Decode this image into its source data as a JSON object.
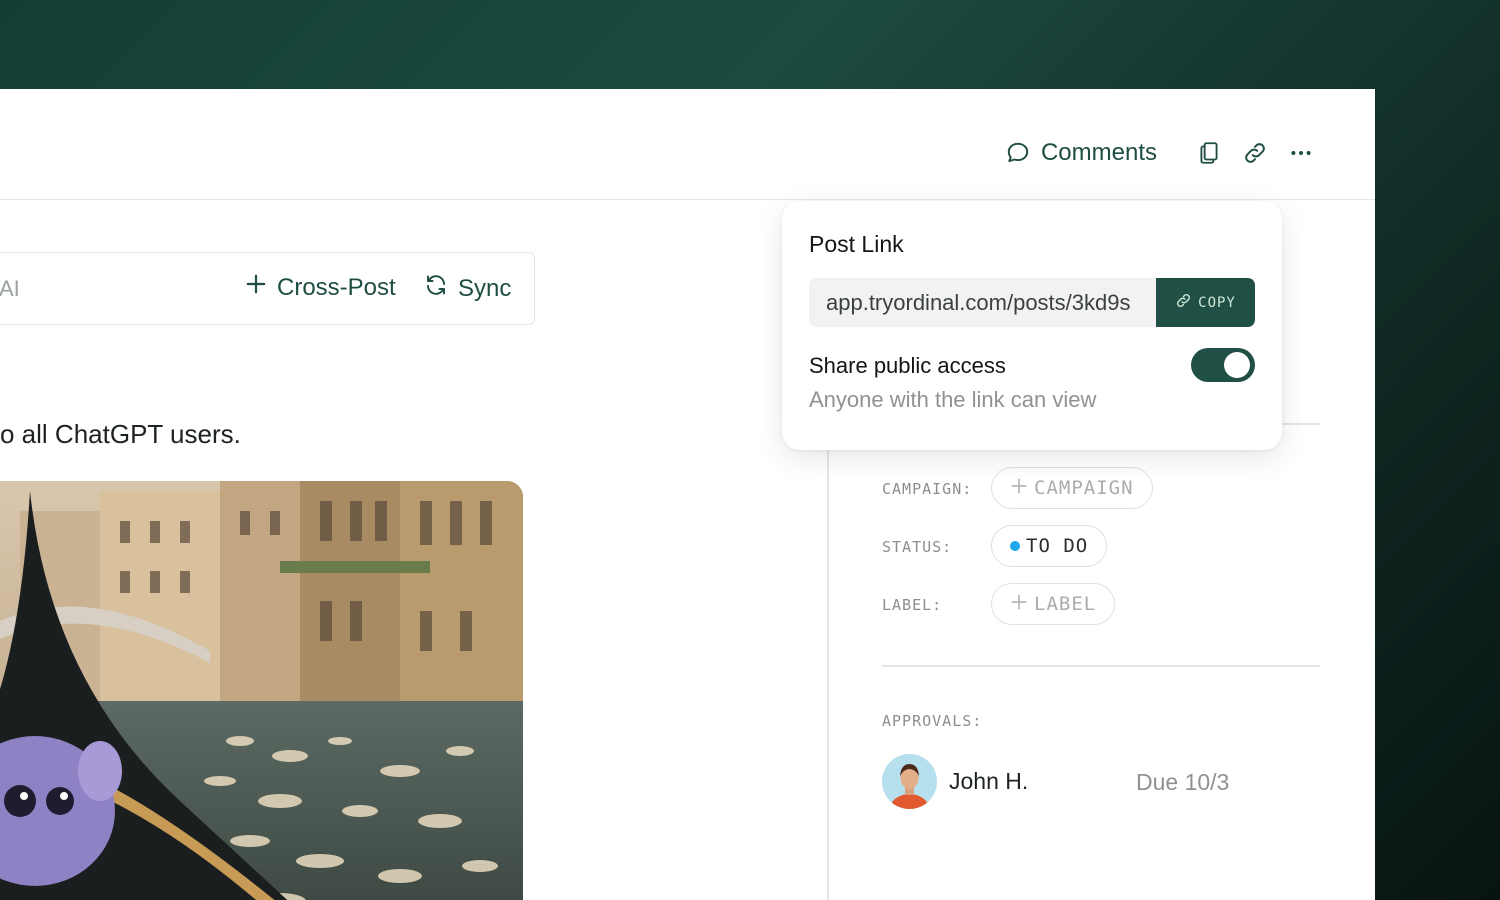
{
  "header": {
    "comments_label": "Comments",
    "actions": [
      "copy-icon",
      "link-icon",
      "more-icon"
    ]
  },
  "composer": {
    "hint_text": "AI",
    "cross_post_label": "Cross-Post",
    "sync_label": "Sync"
  },
  "post": {
    "text": "o all ChatGPT users."
  },
  "popover": {
    "title": "Post Link",
    "link_value": "app.tryordinal.com/posts/3kd9s",
    "copy_label": "COPY",
    "share_title": "Share public access",
    "share_subtitle": "Anyone with the link can view",
    "public_access_enabled": true
  },
  "details": {
    "campaign_label": "CAMPAIGN:",
    "campaign_value": "CAMPAIGN",
    "status_label": "STATUS:",
    "status_value": "TO DO",
    "label_label": "LABEL:",
    "label_value": "LABEL",
    "approvals_label": "APPROVALS:",
    "approver_name": "John H.",
    "approver_due": "Due 10/3"
  },
  "colors": {
    "brand": "#1f4f45",
    "status_dot": "#1fa8ec"
  }
}
